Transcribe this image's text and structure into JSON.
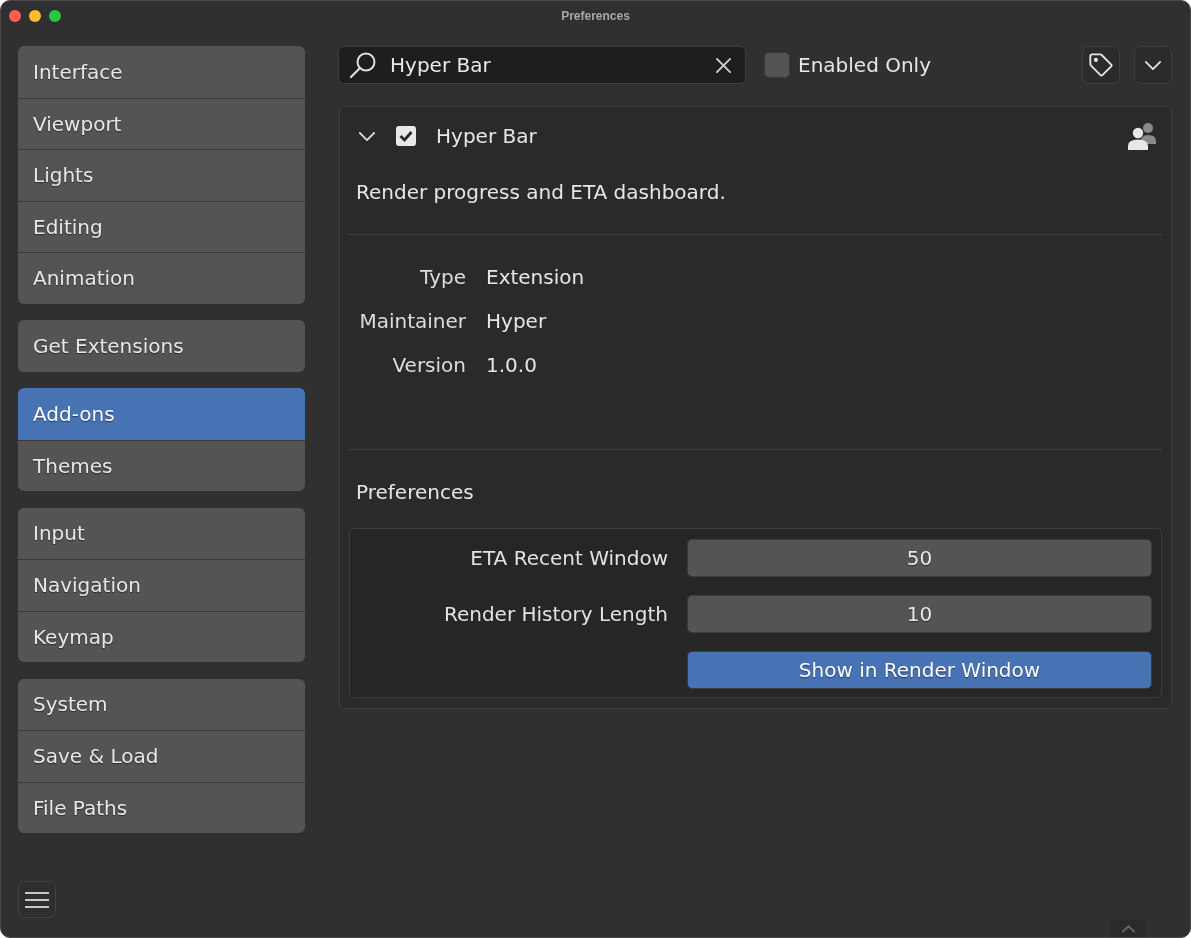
{
  "window": {
    "title": "Preferences"
  },
  "sidebar": {
    "groups": [
      {
        "items": [
          {
            "label": "Interface",
            "selected": false
          },
          {
            "label": "Viewport",
            "selected": false
          },
          {
            "label": "Lights",
            "selected": false
          },
          {
            "label": "Editing",
            "selected": false
          },
          {
            "label": "Animation",
            "selected": false
          }
        ]
      },
      {
        "items": [
          {
            "label": "Get Extensions",
            "selected": false
          }
        ]
      },
      {
        "items": [
          {
            "label": "Add-ons",
            "selected": true
          },
          {
            "label": "Themes",
            "selected": false
          }
        ]
      },
      {
        "items": [
          {
            "label": "Input",
            "selected": false
          },
          {
            "label": "Navigation",
            "selected": false
          },
          {
            "label": "Keymap",
            "selected": false
          }
        ]
      },
      {
        "items": [
          {
            "label": "System",
            "selected": false
          },
          {
            "label": "Save & Load",
            "selected": false
          },
          {
            "label": "File Paths",
            "selected": false
          }
        ]
      }
    ]
  },
  "search": {
    "value": "Hyper Bar"
  },
  "enabled_only": {
    "label": "Enabled Only",
    "checked": false
  },
  "addon": {
    "name": "Hyper Bar",
    "expanded": true,
    "enabled": true,
    "description": "Render progress and ETA dashboard.",
    "info": [
      {
        "label": "Type",
        "value": "Extension"
      },
      {
        "label": "Maintainer",
        "value": "Hyper"
      },
      {
        "label": "Version",
        "value": "1.0.0"
      }
    ],
    "preferences": {
      "title": "Preferences",
      "settings": [
        {
          "kind": "number",
          "label": "ETA Recent Window",
          "value": "50"
        },
        {
          "kind": "number",
          "label": "Render History Length",
          "value": "10"
        },
        {
          "kind": "toggle",
          "label": "Show in Render Window",
          "on": true
        }
      ]
    }
  }
}
